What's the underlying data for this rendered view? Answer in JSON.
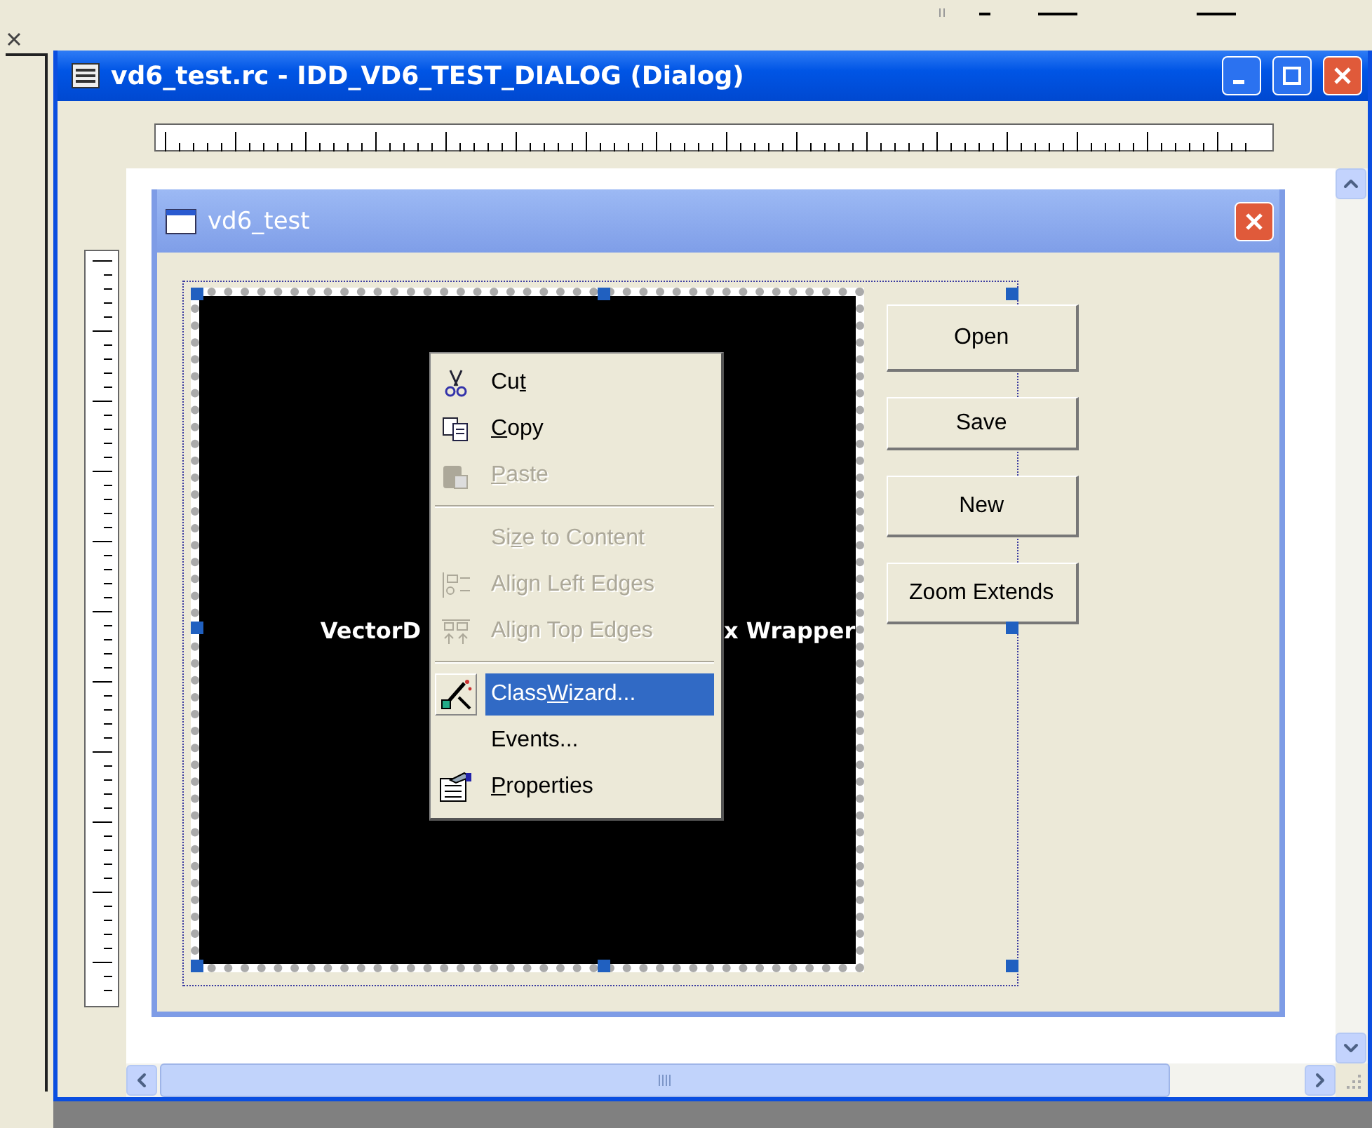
{
  "window": {
    "title": "vd6_test.rc - IDD_VD6_TEST_DIALOG (Dialog)"
  },
  "dialog": {
    "title": "vd6_test",
    "control": {
      "text_left": "VectorD",
      "text_right": "x Wrapper",
      "selected": true
    },
    "buttons": [
      {
        "label": "Open"
      },
      {
        "label": "Save"
      },
      {
        "label": "New"
      },
      {
        "label": "Zoom Extends"
      }
    ]
  },
  "context_menu": {
    "items": [
      {
        "kind": "item",
        "pre": "Cu",
        "key": "t",
        "disabled": false,
        "selected": false
      },
      {
        "kind": "item",
        "key": "C",
        "post": "opy",
        "disabled": false,
        "selected": false
      },
      {
        "kind": "item",
        "key": "P",
        "post": "aste",
        "disabled": true,
        "selected": false
      },
      {
        "kind": "separator"
      },
      {
        "kind": "item",
        "pre": "Si",
        "key": "z",
        "post": "e to Content",
        "disabled": true,
        "selected": false
      },
      {
        "kind": "item",
        "pre": "Align Left Edges",
        "disabled": true,
        "selected": false
      },
      {
        "kind": "item",
        "pre": "Align Top Edges",
        "disabled": true,
        "selected": false
      },
      {
        "kind": "separator"
      },
      {
        "kind": "item",
        "pre": "Class",
        "key": "W",
        "post": "izard...",
        "disabled": false,
        "selected": true
      },
      {
        "kind": "item",
        "pre": "Events...",
        "disabled": false,
        "selected": false
      },
      {
        "kind": "item",
        "key": "P",
        "post": "roperties",
        "disabled": false,
        "selected": false
      }
    ]
  }
}
